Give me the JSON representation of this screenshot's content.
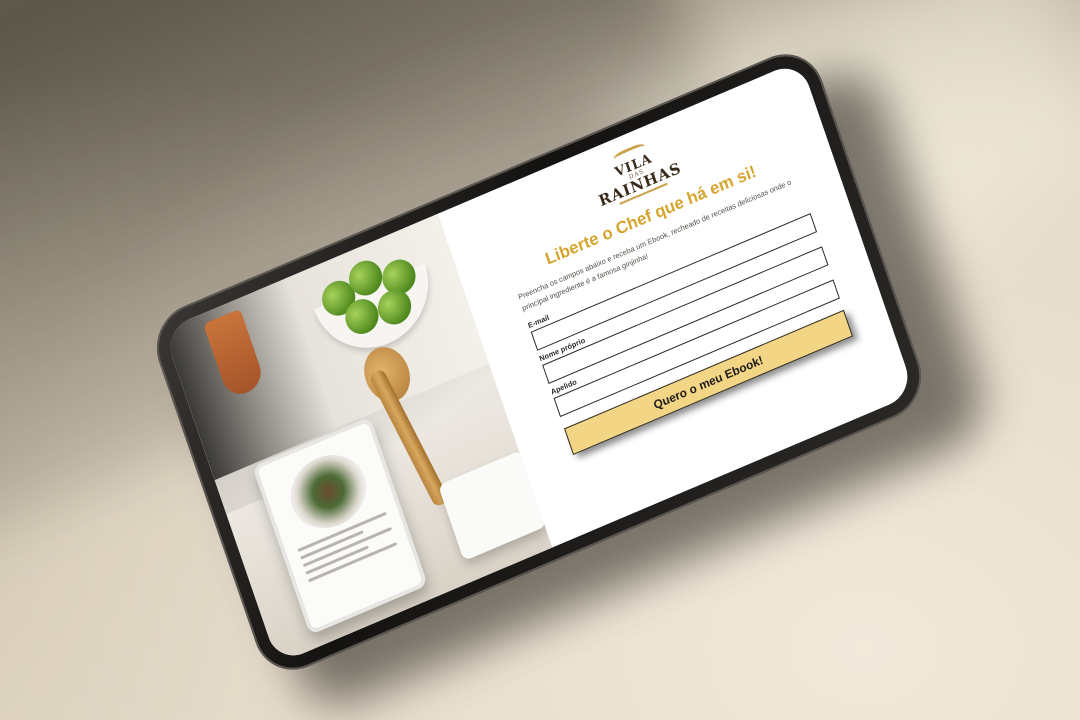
{
  "logo": {
    "top": "VILA",
    "mid": "DAS",
    "bottom": "RAINHAS"
  },
  "headline": "Liberte o Chef que há em si!",
  "intro": "Preencha os campos abaixo e receba um Ebook, recheado de receitas deliciosas onde o principal ingrediente é a famosa ginjinha!",
  "form": {
    "email_label": "E-mail",
    "email_value": "",
    "first_name_label": "Nome próprio",
    "first_name_value": "",
    "last_name_label": "Apelido",
    "last_name_value": "",
    "submit_label": "Quero o meu Ebook!"
  },
  "colors": {
    "headline": "#d5a52e",
    "button": "#f2d585",
    "logo_accent": "#c9a24a"
  }
}
